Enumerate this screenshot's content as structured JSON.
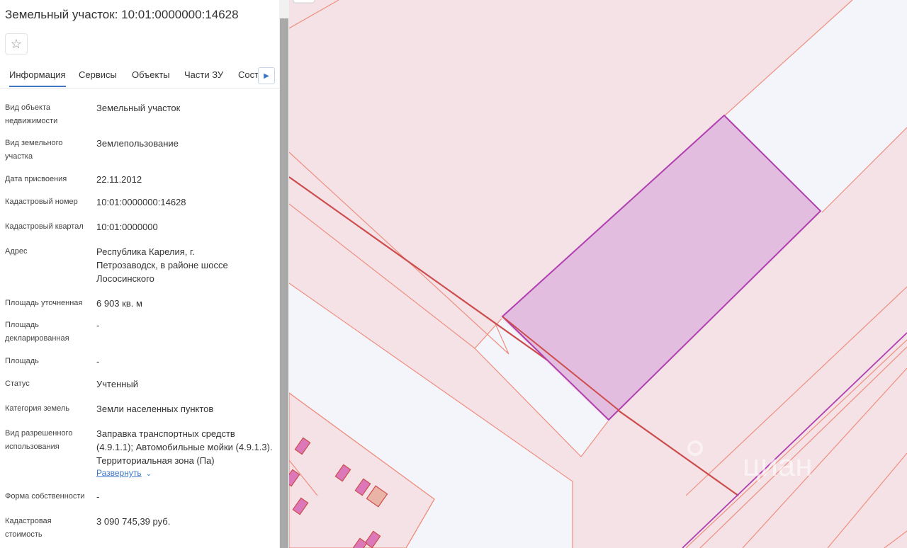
{
  "panel": {
    "title": "Земельный участок: 10:01:0000000:14628",
    "favorite_icon": "star-outline-icon",
    "tabs": [
      {
        "label": "Информация"
      },
      {
        "label": "Сервисы"
      },
      {
        "label": "Объекты"
      },
      {
        "label": "Части ЗУ"
      },
      {
        "label": "Состав"
      }
    ],
    "fields": [
      {
        "label": "Вид объекта недвижимости",
        "value": "Земельный участок"
      },
      {
        "label": "Вид земельного участка",
        "value": "Землепользование"
      },
      {
        "label": "Дата присвоения",
        "value": "22.11.2012"
      },
      {
        "label": "Кадастровый номер",
        "value": "10:01:0000000:14628"
      },
      {
        "label": "Кадастровый квартал",
        "value": "10:01:0000000"
      },
      {
        "label": "Адрес",
        "value": "Республика Карелия, г. Петрозаводск, в районе шоссе Лососинского"
      },
      {
        "label": "Площадь уточненная",
        "value": "6 903 кв. м"
      },
      {
        "label": "Площадь декларированная",
        "value": "-"
      },
      {
        "label": "Площадь",
        "value": "-"
      },
      {
        "label": "Статус",
        "value": "Учтенный"
      },
      {
        "label": "Категория земель",
        "value": "Земли населенных пунктов"
      },
      {
        "label": "Вид разрешенного использования",
        "value": "Заправка транспортных средств (4.9.1.1); Автомобильные мойки (4.9.1.3). Территориальная зона (Па)"
      },
      {
        "label": "Форма собственности",
        "value": "-"
      },
      {
        "label": "Кадастровая стоимость",
        "value": "3 090 745,39 руб."
      }
    ],
    "expand_label": "Развернуть"
  },
  "map": {
    "watermark": "циан",
    "colors": {
      "parcel_fill": "#f4e2e7",
      "parcel_stroke": "#ee8f7f",
      "road_fill": "#f4f5fb",
      "selected_fill": "#e3bddf",
      "selected_stroke": "#b03fb0",
      "line": "#cd4d4d",
      "building_fill": "#dc78b9"
    }
  }
}
